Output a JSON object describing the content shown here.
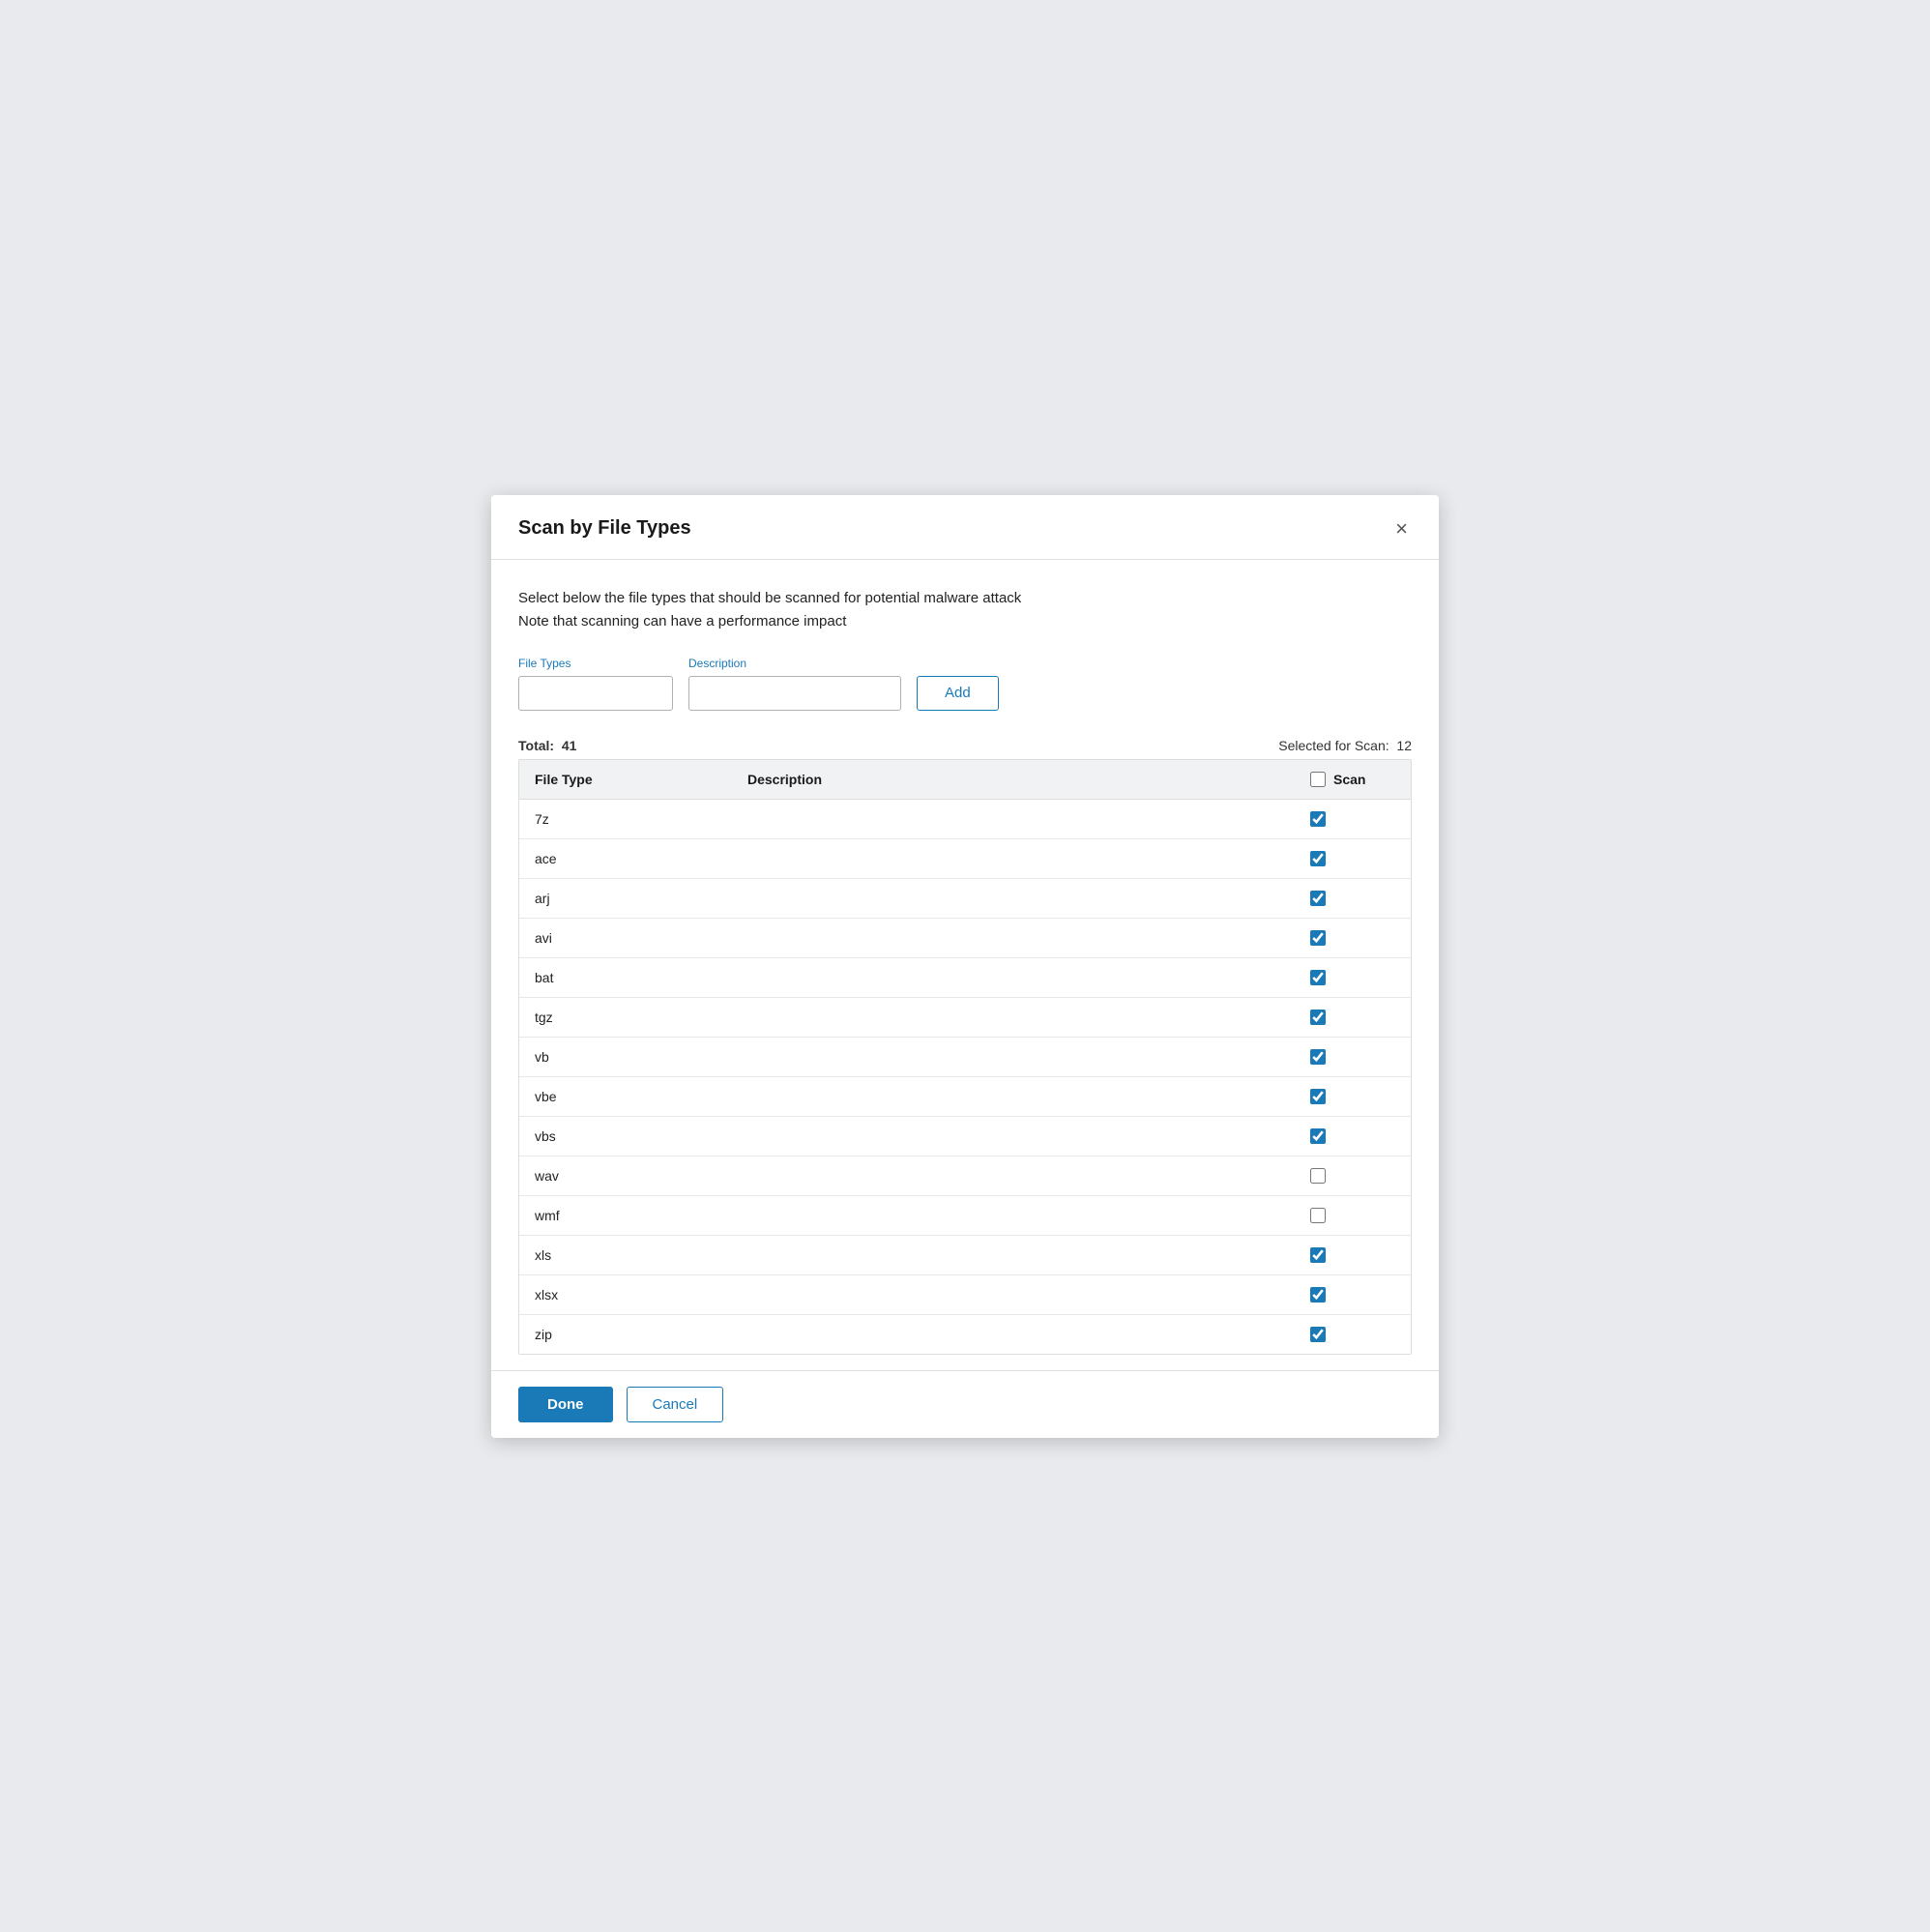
{
  "dialog": {
    "title": "Scan by File Types",
    "close_label": "×"
  },
  "description": {
    "line1": "Select below the file types that should be scanned for potential malware attack",
    "line2": "Note that scanning can have a performance impact"
  },
  "form": {
    "file_types_label": "File Types",
    "description_label": "Description",
    "file_types_placeholder": "",
    "description_placeholder": "",
    "add_button": "Add"
  },
  "stats": {
    "total_label": "Total:",
    "total_value": "41",
    "selected_label": "Selected for Scan:",
    "selected_value": "12"
  },
  "table": {
    "col_file_type": "File Type",
    "col_description": "Description",
    "col_scan": "Scan",
    "rows": [
      {
        "file_type": "7z",
        "description": "",
        "checked": true
      },
      {
        "file_type": "ace",
        "description": "",
        "checked": true
      },
      {
        "file_type": "arj",
        "description": "",
        "checked": true
      },
      {
        "file_type": "avi",
        "description": "",
        "checked": true
      },
      {
        "file_type": "bat",
        "description": "",
        "checked": true
      },
      {
        "file_type": "tgz",
        "description": "",
        "checked": true
      },
      {
        "file_type": "vb",
        "description": "",
        "checked": true
      },
      {
        "file_type": "vbe",
        "description": "",
        "checked": true
      },
      {
        "file_type": "vbs",
        "description": "",
        "checked": true
      },
      {
        "file_type": "wav",
        "description": "",
        "checked": false
      },
      {
        "file_type": "wmf",
        "description": "",
        "checked": false
      },
      {
        "file_type": "xls",
        "description": "",
        "checked": true
      },
      {
        "file_type": "xlsx",
        "description": "",
        "checked": true
      },
      {
        "file_type": "zip",
        "description": "",
        "checked": true
      }
    ]
  },
  "footer": {
    "done_label": "Done",
    "cancel_label": "Cancel"
  }
}
